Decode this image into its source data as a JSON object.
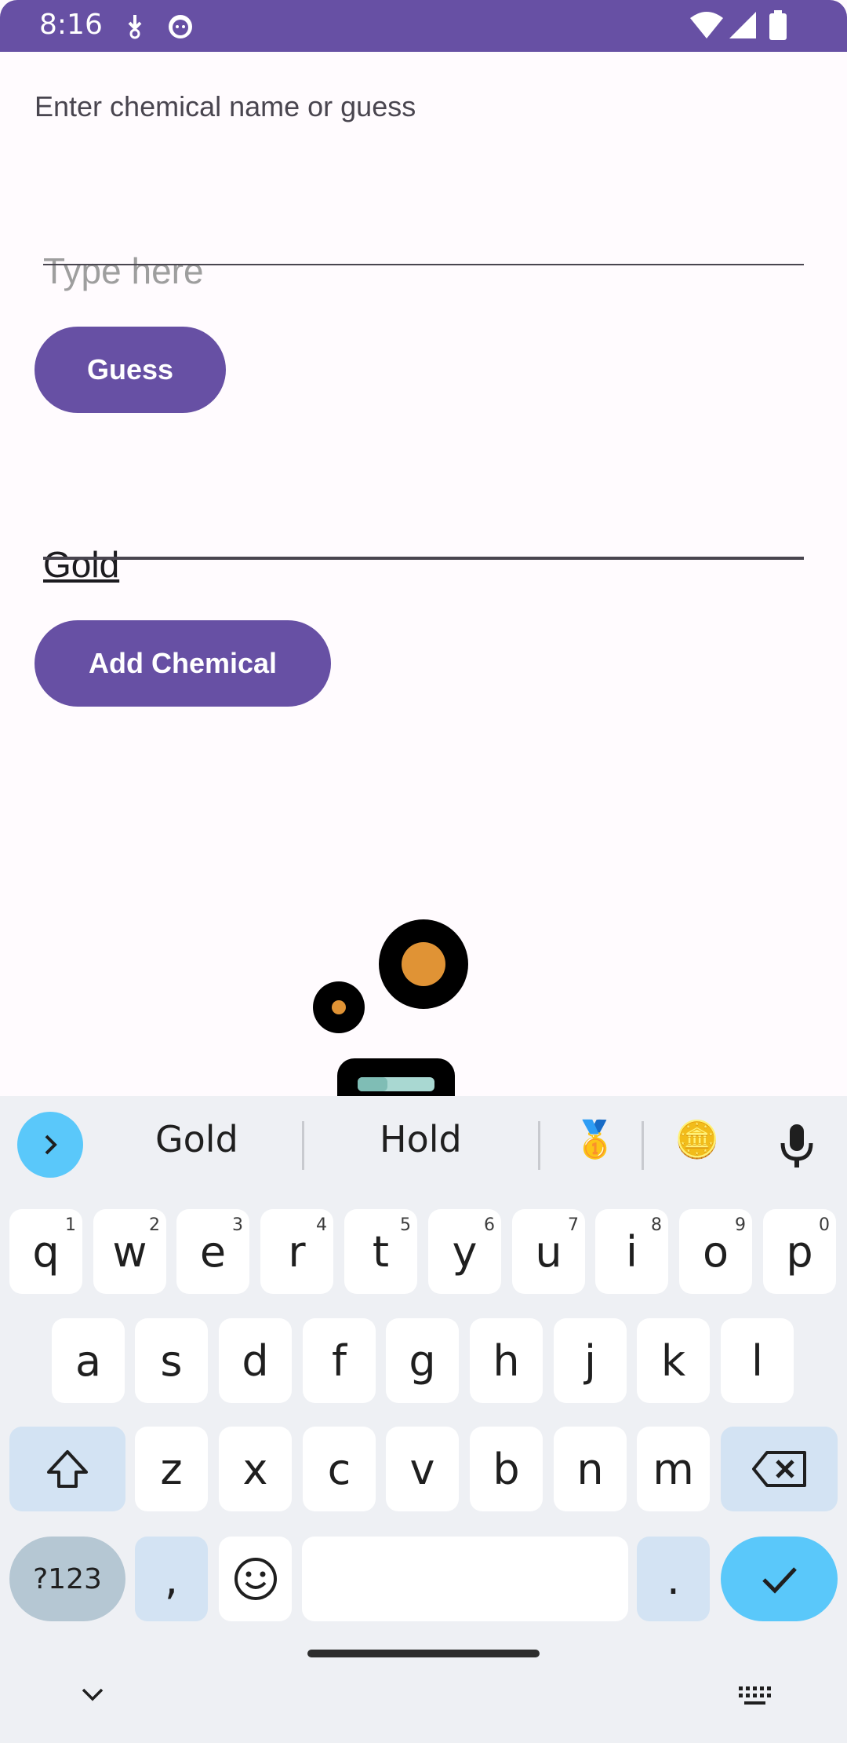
{
  "status_bar": {
    "time": "8:16",
    "icons": [
      "download-icon",
      "cat-notification-icon",
      "wifi-icon",
      "signal-icon",
      "battery-icon"
    ],
    "color": "#6750a4"
  },
  "main": {
    "prompt_label": "Enter chemical name or guess",
    "guess_input": {
      "placeholder": "Type here",
      "value": ""
    },
    "guess_button": "Guess",
    "chemical_input": {
      "value": "Gold"
    },
    "add_button": "Add Chemical",
    "illustration": "molecule-illustration"
  },
  "keyboard": {
    "suggestions": [
      "Gold",
      "Hold",
      "🥇",
      "🪙"
    ],
    "row1": [
      {
        "k": "q",
        "hint": "1"
      },
      {
        "k": "w",
        "hint": "2"
      },
      {
        "k": "e",
        "hint": "3"
      },
      {
        "k": "r",
        "hint": "4"
      },
      {
        "k": "t",
        "hint": "5"
      },
      {
        "k": "y",
        "hint": "6"
      },
      {
        "k": "u",
        "hint": "7"
      },
      {
        "k": "i",
        "hint": "8"
      },
      {
        "k": "o",
        "hint": "9"
      },
      {
        "k": "p",
        "hint": "0"
      }
    ],
    "row2": [
      "a",
      "s",
      "d",
      "f",
      "g",
      "h",
      "j",
      "k",
      "l"
    ],
    "row3": [
      "z",
      "x",
      "c",
      "v",
      "b",
      "n",
      "m"
    ],
    "symbols_key": "?123",
    "comma_key": ",",
    "period_key": ".",
    "accent_color": "#5ac8fa"
  }
}
